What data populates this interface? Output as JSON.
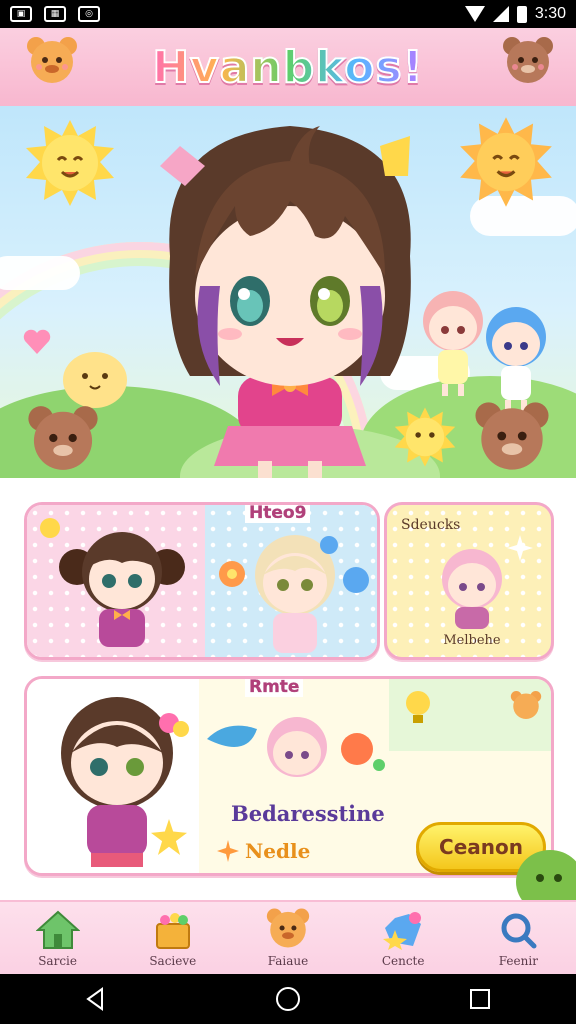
{
  "status_bar": {
    "time": "3:30"
  },
  "header": {
    "title": "Hvanbkos!"
  },
  "panels": {
    "top": {
      "label": "Hteo9",
      "side_label": "Sdeucks",
      "side_caption": "Melbehe"
    },
    "bottom": {
      "label": "Rmte",
      "description": "Bedaresstine",
      "tag": "Nedle",
      "cta_label": "Ceanon"
    }
  },
  "bottom_nav": {
    "items": [
      {
        "label": "Sarcie",
        "icon": "house-icon"
      },
      {
        "label": "Sacieve",
        "icon": "basket-icon"
      },
      {
        "label": "Faiaue",
        "icon": "bear-icon"
      },
      {
        "label": "Cencte",
        "icon": "gem-star-icon"
      },
      {
        "label": "Feenir",
        "icon": "magnifier-icon"
      }
    ]
  },
  "colors": {
    "header_pink": "#f8b7cf",
    "panel_border": "#f3a8c8",
    "cta_yellow": "#f4c71c",
    "accent_text": "#b0407a"
  }
}
